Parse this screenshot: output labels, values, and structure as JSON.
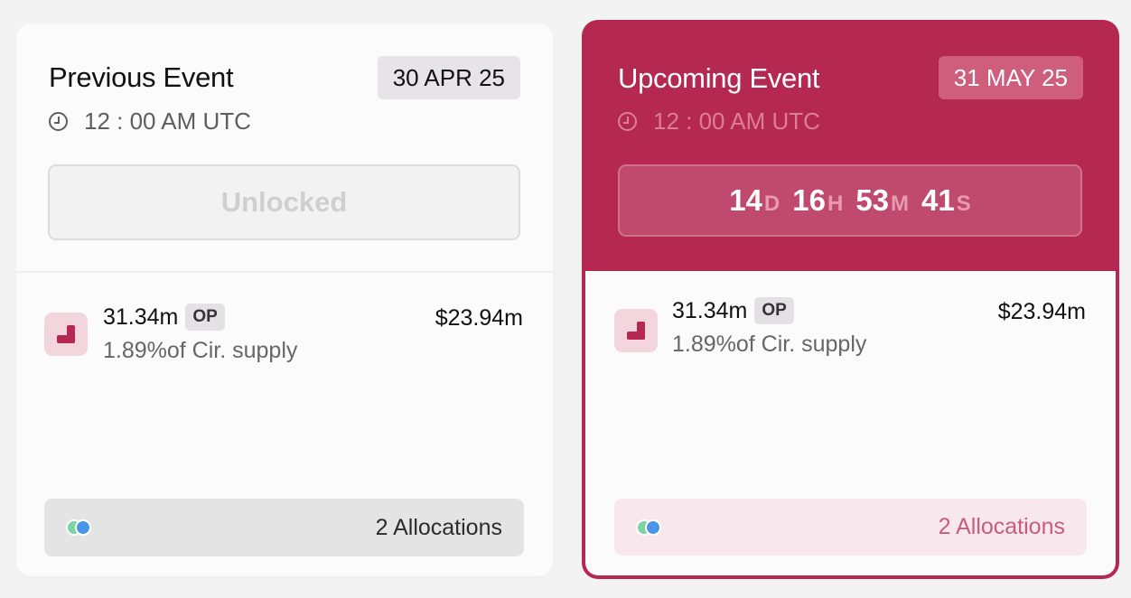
{
  "previous": {
    "title": "Previous Event",
    "date": "30 APR 25",
    "time": "12 : 00 AM UTC",
    "status": "Unlocked",
    "amount": "31.34m",
    "token": "OP",
    "supply": "1.89%of Cir. supply",
    "usd": "$23.94m",
    "allocations": "2 Allocations"
  },
  "upcoming": {
    "title": "Upcoming Event",
    "date": "31 MAY 25",
    "time": "12 : 00 AM UTC",
    "countdown": {
      "days": "14",
      "days_unit": "D",
      "hours": "16",
      "hours_unit": "H",
      "minutes": "53",
      "minutes_unit": "M",
      "seconds": "41",
      "seconds_unit": "S"
    },
    "amount": "31.34m",
    "token": "OP",
    "supply": "1.89%of Cir. supply",
    "usd": "$23.94m",
    "allocations": "2 Allocations"
  },
  "colors": {
    "accent": "#b52851",
    "allocation_dot_1": "#7ed3a4",
    "allocation_dot_2": "#4a95e8"
  },
  "icons": {
    "clock": "clock-icon",
    "token": "op-token-icon",
    "allocations": "allocation-dots-icon"
  }
}
